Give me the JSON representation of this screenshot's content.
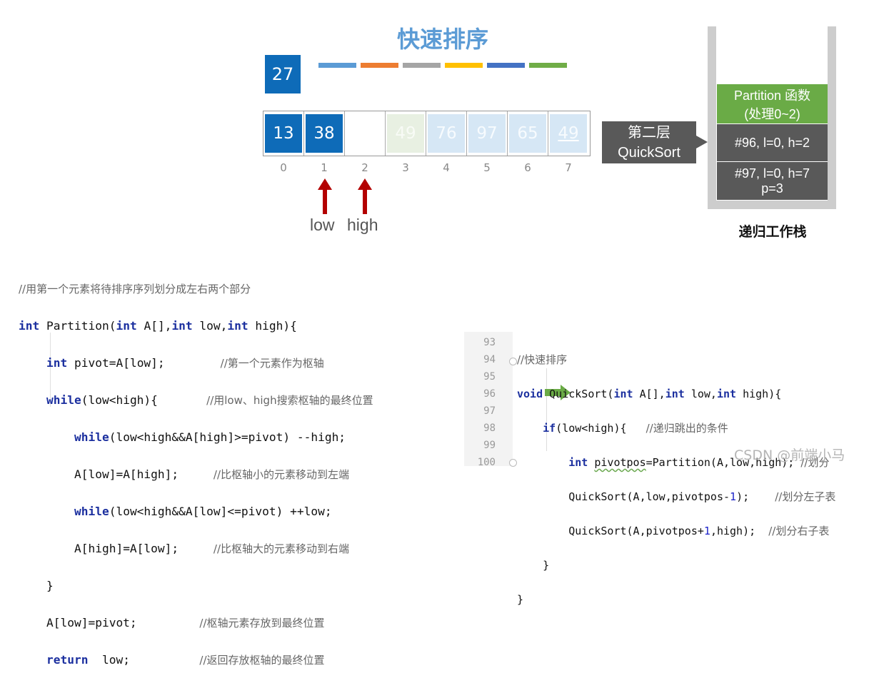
{
  "title": "快速排序",
  "pivot_value": "27",
  "color_bars": [
    "#5b9bd5",
    "#ed7d31",
    "#a5a5a5",
    "#ffc000",
    "#4472c4",
    "#70ad47"
  ],
  "array_cells": [
    {
      "value": "13",
      "state": "dark"
    },
    {
      "value": "38",
      "state": "dark"
    },
    {
      "value": "",
      "state": "empty"
    },
    {
      "value": "49",
      "state": "green"
    },
    {
      "value": "76",
      "state": "light"
    },
    {
      "value": "97",
      "state": "light"
    },
    {
      "value": "65",
      "state": "light"
    },
    {
      "value": "49",
      "state": "light"
    }
  ],
  "indices": [
    "0",
    "1",
    "2",
    "3",
    "4",
    "5",
    "6",
    "7"
  ],
  "pointers": {
    "low_label": "low",
    "high_label": "high",
    "arrow_color": "#b30000"
  },
  "callout": {
    "line1": "第二层",
    "line2": "QuickSort"
  },
  "stack": {
    "frames": [
      {
        "line1": "Partition 函数",
        "line2": "(处理0~2)"
      },
      {
        "line1": "#96, l=0, h=2",
        "line2": ""
      },
      {
        "line1": "#97, l=0, h=7",
        "line2": "p=3"
      }
    ],
    "caption": "递归工作栈"
  },
  "code_left": {
    "comment_header": "//用第一个元素将待排序序列划分成左右两个部分",
    "l1_kw": "int",
    "l1_a": " Partition(",
    "l1_kw2": "int",
    "l1_b": " A[],",
    "l1_kw3": "int",
    "l1_c": " low,",
    "l1_kw4": "int",
    "l1_d": " high){",
    "l2_kw": "int",
    "l2_code": " pivot=A[low];",
    "l2_cm": "//第一个元素作为枢轴",
    "l3_kw": "while",
    "l3_code": "(low<high){",
    "l3_cm": "//用low、high搜索枢轴的最终位置",
    "l4_kw": "while",
    "l4_code": "(low<high&&A[high]>=pivot) --high;",
    "l5_code": "A[low]=A[high];",
    "l5_cm": "//比枢轴小的元素移动到左端",
    "l6_kw": "while",
    "l6_code": "(low<high&&A[low]<=pivot) ++low;",
    "l7_code": "A[high]=A[low];",
    "l7_cm": "//比枢轴大的元素移动到右端",
    "l8_code": "}",
    "l9_code": "A[low]=pivot;",
    "l9_cm": "//枢轴元素存放到最终位置",
    "l10_kw": "return",
    "l10_code": "  low;",
    "l10_cm": "//返回存放枢轴的最终位置"
  },
  "ide": {
    "line_numbers": [
      "93",
      "94",
      "95",
      "96",
      "97",
      "98",
      "99",
      "100"
    ],
    "l93_cm": "//快速排序",
    "l94_kw": "void",
    "l94_a": " QuickSort(",
    "l94_kw2": "int",
    "l94_b": " A[],",
    "l94_kw3": "int",
    "l94_c": " low,",
    "l94_kw4": "int",
    "l94_d": " high){",
    "l95_kw": "if",
    "l95_code": "(low<high){",
    "l95_cm": "//递归跳出的条件",
    "l96_kw": "int",
    "l96_var": "pivotpos",
    "l96_code": "=Partition(A,low,high);",
    "l96_cm": "//划分",
    "l97_a": "QuickSort(A,low,pivotpos-",
    "l97_num": "1",
    "l97_b": ");",
    "l97_cm": "//划分左子表",
    "l98_a": "QuickSort(A,pivotpos+",
    "l98_num": "1",
    "l98_b": ",high);",
    "l98_cm": "//划分右子表",
    "l99_code": "}",
    "l100_code": "}",
    "exec_arrow_color": "#6aab46"
  },
  "watermark": "CSDN @前端小马"
}
